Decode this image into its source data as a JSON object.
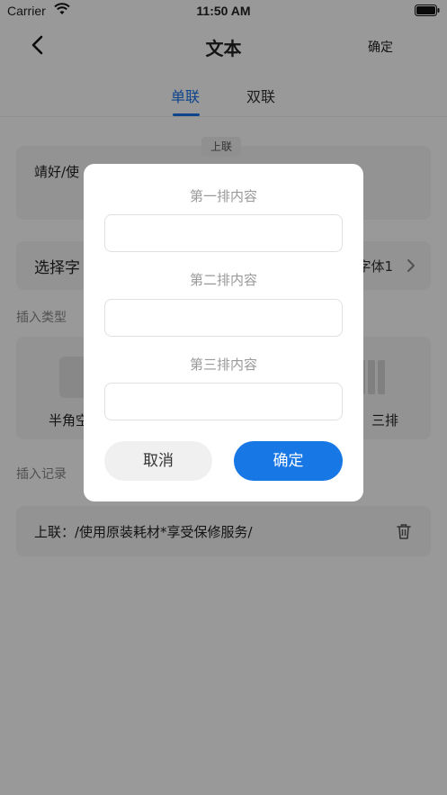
{
  "status_bar": {
    "carrier": "Carrier",
    "time": "11:50 AM"
  },
  "nav": {
    "title": "文本",
    "confirm_label": "确定"
  },
  "tabs": [
    {
      "label": "单联",
      "active": true
    },
    {
      "label": "双联",
      "active": false
    }
  ],
  "text_card": {
    "badge": "上联",
    "content": "靖好/使"
  },
  "font_row": {
    "label": "选择字",
    "value": "字体1"
  },
  "insert_type": {
    "section_label": "插入类型",
    "left_label": "半角空",
    "right_label": "三排"
  },
  "insert_record": {
    "section_label": "插入记录",
    "item": "上联：/使用原装耗材*享受保修服务/"
  },
  "modal": {
    "row1_label": "第一排内容",
    "row2_label": "第二排内容",
    "row3_label": "第三排内容",
    "row1_value": "",
    "row2_value": "",
    "row3_value": "",
    "cancel_label": "取消",
    "ok_label": "确定"
  },
  "colors": {
    "accent": "#1677e5",
    "overlay": "rgba(0,0,0,0.4)"
  }
}
